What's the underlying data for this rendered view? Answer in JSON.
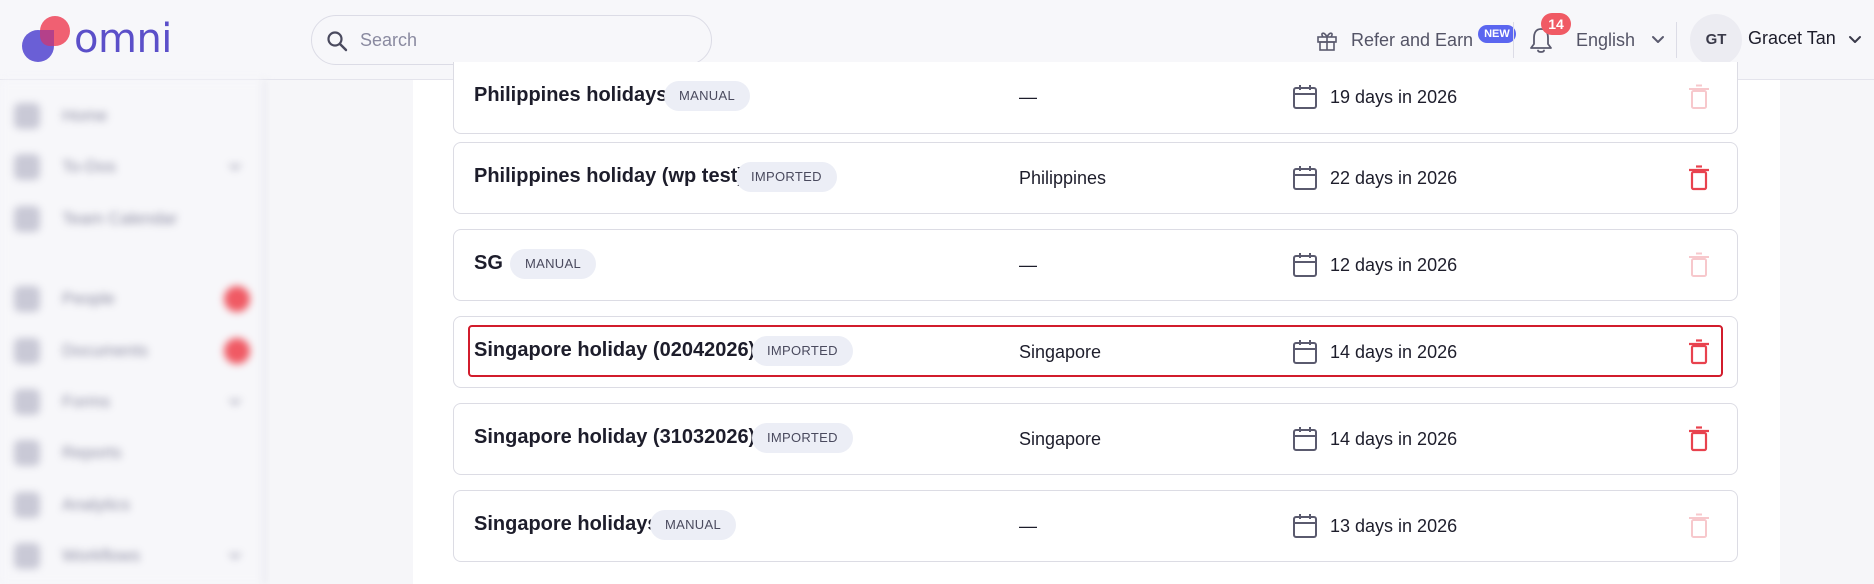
{
  "app": {
    "logo_text": "omni",
    "brand_color": "#5b4fc9",
    "accent_red": "#f05a64"
  },
  "header": {
    "search": {
      "placeholder": "Search",
      "value": ""
    },
    "refer": {
      "label": "Refer and Earn",
      "badge": "NEW",
      "icon": "gift-icon"
    },
    "notifications": {
      "count": "14",
      "icon": "bell-icon"
    },
    "language": {
      "selected": "English"
    },
    "user": {
      "initials": "GT",
      "name": "Gracet Tan"
    }
  },
  "sidebar": {
    "items": [
      {
        "label": "Home",
        "icon": "home-icon"
      },
      {
        "label": "To-Dos",
        "icon": "checklist-icon",
        "expandable": true
      },
      {
        "label": "Team Calendar",
        "icon": "calendar-icon"
      },
      {
        "label": "People",
        "icon": "people-icon",
        "dot": true
      },
      {
        "label": "Documents",
        "icon": "documents-icon",
        "dot": true
      },
      {
        "label": "Forms",
        "icon": "forms-icon",
        "expandable": true
      },
      {
        "label": "Reports",
        "icon": "reports-icon"
      },
      {
        "label": "Analytics",
        "icon": "analytics-icon"
      },
      {
        "label": "Workflows",
        "icon": "workflows-icon",
        "expandable": true
      }
    ]
  },
  "holidays": {
    "rows": [
      {
        "name": "Philippines holidays",
        "type": "MANUAL",
        "country": "—",
        "days": "19 days in 2026",
        "delete_enabled": false
      },
      {
        "name": "Philippines holiday (wp test)",
        "type": "IMPORTED",
        "country": "Philippines",
        "days": "22 days in 2026",
        "delete_enabled": true
      },
      {
        "name": "SG",
        "type": "MANUAL",
        "country": "—",
        "days": "12 days in 2026",
        "delete_enabled": false
      },
      {
        "name": "Singapore holiday (02042026)",
        "type": "IMPORTED",
        "country": "Singapore",
        "days": "14 days in 2026",
        "delete_enabled": true,
        "highlighted": true
      },
      {
        "name": "Singapore holiday (31032026)",
        "type": "IMPORTED",
        "country": "Singapore",
        "days": "14 days in 2026",
        "delete_enabled": true
      },
      {
        "name": "Singapore holidays",
        "type": "MANUAL",
        "country": "—",
        "days": "13 days in 2026",
        "delete_enabled": false
      }
    ]
  }
}
